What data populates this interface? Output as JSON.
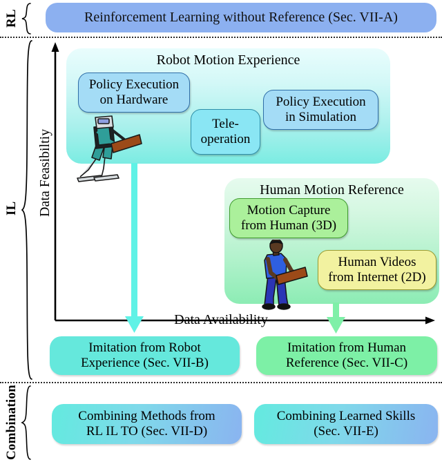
{
  "diagram": {
    "sections": [
      {
        "id": "rl",
        "label": "RL"
      },
      {
        "id": "il",
        "label": "IL"
      },
      {
        "id": "combination",
        "label": "Combination"
      }
    ],
    "rl_box": {
      "label": "Reinforcement Learning without Reference (Sec. VII-A)"
    },
    "axes": {
      "y_label": "Data Feasibiltiy",
      "x_label": "Data Availability"
    },
    "groups": [
      {
        "id": "robot-motion-experience",
        "title": "Robot Motion Experience",
        "items": [
          {
            "id": "policy-execution-on-hardware",
            "label": "Policy Execution\non Hardware",
            "line1": "Policy Execution",
            "line2": "on Hardware",
            "color": "#a4dcf6"
          },
          {
            "id": "tele-operation",
            "label": "Tele-\noperation",
            "line1": "Tele-",
            "line2": "operation",
            "color": "#8ae6f4"
          },
          {
            "id": "policy-execution-in-simulation",
            "label": "Policy Execution\nin Simulation",
            "line1": "Policy Execution",
            "line2": "in Simulation",
            "color": "#a4dcf6"
          }
        ],
        "figure": "humanoid-robot-carrying-board"
      },
      {
        "id": "human-motion-reference",
        "title": "Human Motion Reference",
        "items": [
          {
            "id": "motion-capture-from-human",
            "label": "Motion Capture\nfrom Human (3D)",
            "line1": "Motion Capture",
            "line2": "from Human (3D)",
            "color": "#abf09b"
          },
          {
            "id": "human-videos-from-internet",
            "label": "Human Videos\nfrom Internet (2D)",
            "line1": "Human Videos",
            "line2": "from Internet (2D)",
            "color": "#f2f2a0"
          }
        ],
        "figure": "person-carrying-board"
      }
    ],
    "outcomes": [
      {
        "id": "imitation-from-robot-experience",
        "line1": "Imitation from Robot",
        "line2": "Experience (Sec. VII-B)",
        "color": "#65e8dc",
        "arrow_color": "#5ff2e6"
      },
      {
        "id": "imitation-from-human-reference",
        "line1": "Imitation from Human",
        "line2": "Reference (Sec. VII-C)",
        "color": "#7df0a6",
        "arrow_color": "#7ff0a8"
      }
    ],
    "combination_boxes": [
      {
        "id": "combining-methods",
        "line1": "Combining Methods from",
        "line2": "RL IL TO (Sec. VII-D)"
      },
      {
        "id": "combining-learned-skills",
        "line1": "Combining Learned Skills",
        "line2": "(Sec. VII-E)"
      }
    ]
  }
}
